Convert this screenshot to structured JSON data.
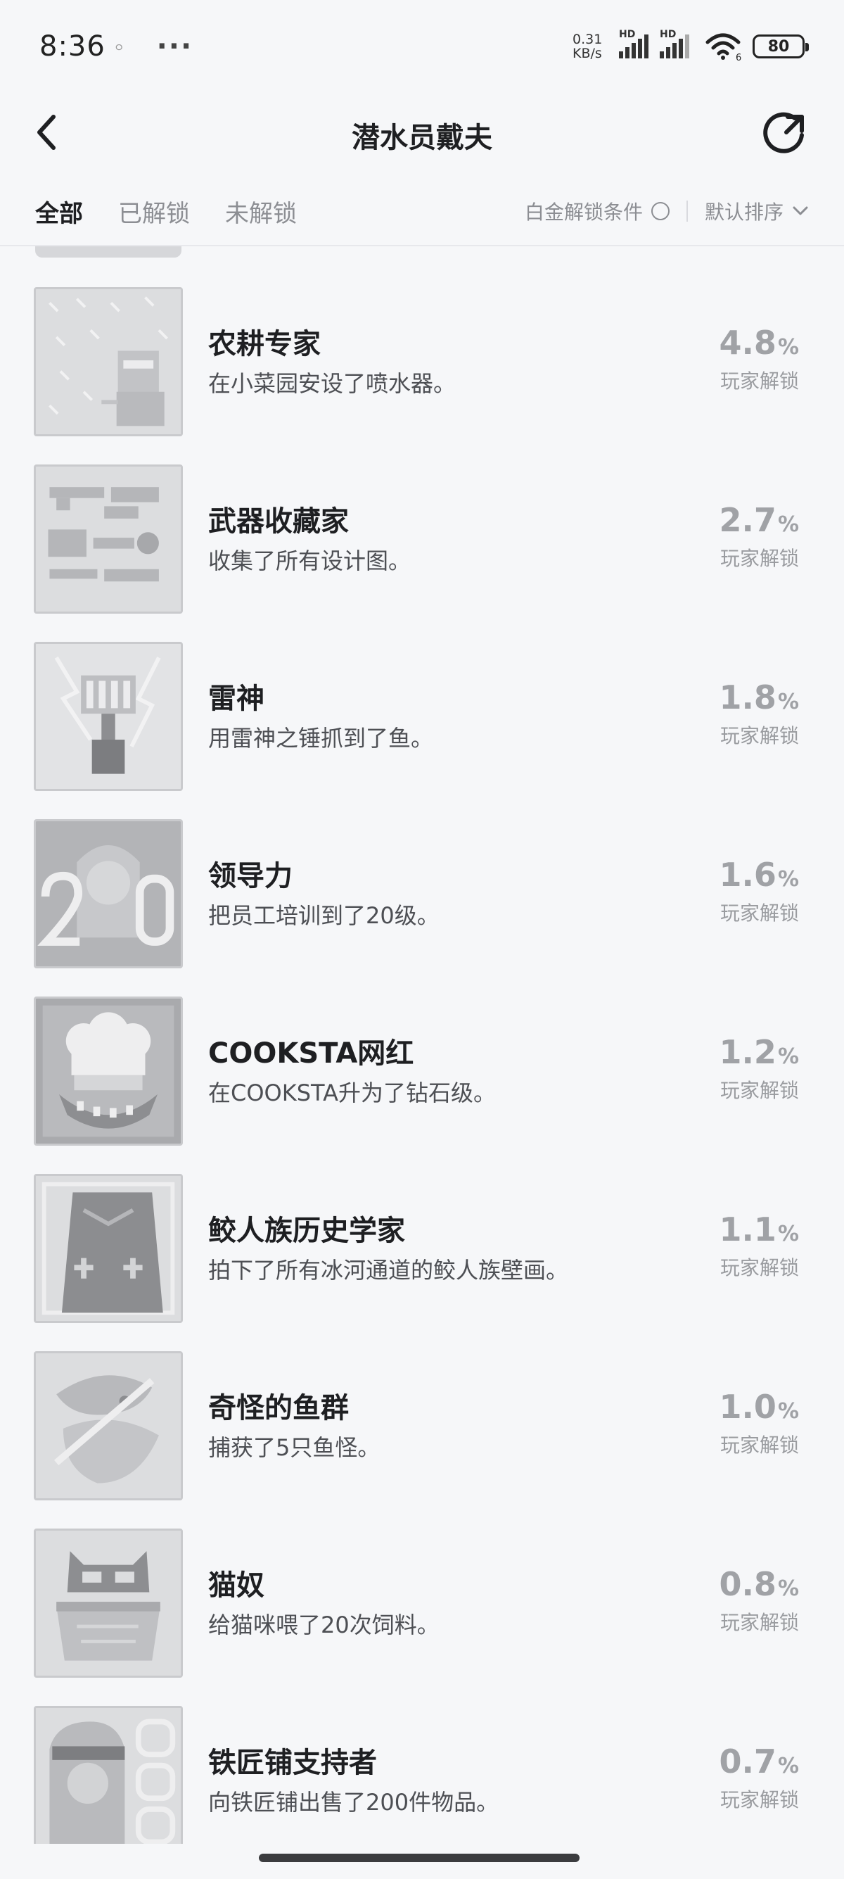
{
  "status_bar": {
    "time": "8:36",
    "dots": "···",
    "mini": "ㅇ",
    "net_speed": "0.31 KB/s",
    "sim1_label": "HD",
    "sim2_label": "HD",
    "wifi_sub": "6",
    "battery": "80"
  },
  "header": {
    "title": "潜水员戴夫",
    "back_icon": "chevron-left-icon",
    "share_icon": "share-refresh-icon"
  },
  "filter": {
    "tabs": [
      {
        "label": "全部",
        "active": true
      },
      {
        "label": "已解锁",
        "active": false
      },
      {
        "label": "未解锁",
        "active": false
      }
    ],
    "platinum_label": "白金解锁条件",
    "sort_label": "默认排序"
  },
  "achievements": [
    {
      "title": "农耕专家",
      "desc": "在小菜园安设了喷水器。",
      "rate": "4.8",
      "pct": "%",
      "rate_label": "玩家解锁",
      "icon": "farm-sprinkler-icon"
    },
    {
      "title": "武器收藏家",
      "desc": "收集了所有设计图。",
      "rate": "2.7",
      "pct": "%",
      "rate_label": "玩家解锁",
      "icon": "weapons-collection-icon"
    },
    {
      "title": "雷神",
      "desc": "用雷神之锤抓到了鱼。",
      "rate": "1.8",
      "pct": "%",
      "rate_label": "玩家解锁",
      "icon": "thunder-hammer-icon"
    },
    {
      "title": "领导力",
      "desc": "把员工培训到了20级。",
      "rate": "1.6",
      "pct": "%",
      "rate_label": "玩家解锁",
      "icon": "leadership-20-icon"
    },
    {
      "title": "COOKSTA网红",
      "desc": "在COOKSTA升为了钻石级。",
      "rate": "1.2",
      "pct": "%",
      "rate_label": "玩家解锁",
      "icon": "chef-hat-icon"
    },
    {
      "title": "鲛人族历史学家",
      "desc": "拍下了所有冰河通道的鲛人族壁画。",
      "rate": "1.1",
      "pct": "%",
      "rate_label": "玩家解锁",
      "icon": "mural-tablet-icon"
    },
    {
      "title": "奇怪的鱼群",
      "desc": "捕获了5只鱼怪。",
      "rate": "1.0",
      "pct": "%",
      "rate_label": "玩家解锁",
      "icon": "strange-fish-icon"
    },
    {
      "title": "猫奴",
      "desc": "给猫咪喂了20次饲料。",
      "rate": "0.8",
      "pct": "%",
      "rate_label": "玩家解锁",
      "icon": "cat-feeding-icon"
    },
    {
      "title": "铁匠铺支持者",
      "desc": "向铁匠铺出售了200件物品。",
      "rate": "0.7",
      "pct": "%",
      "rate_label": "玩家解锁",
      "icon": "blacksmith-200-icon"
    }
  ]
}
